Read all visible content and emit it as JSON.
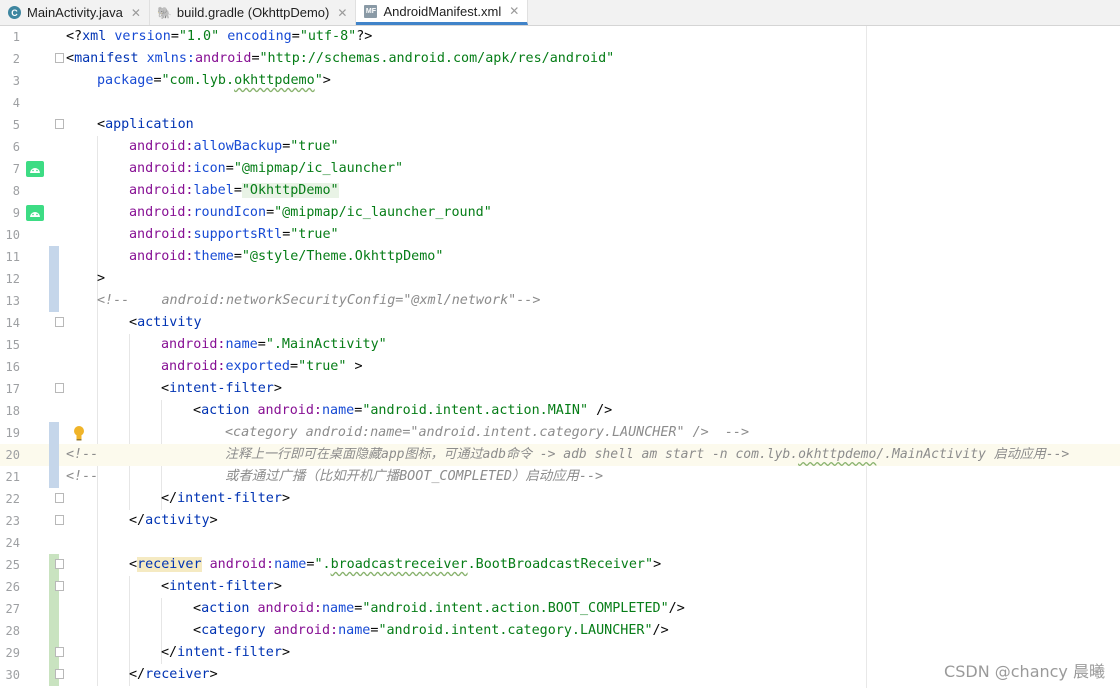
{
  "tabs": [
    {
      "label": "MainActivity.java",
      "icon": "class-icon",
      "active": false
    },
    {
      "label": "build.gradle (OkhttpDemo)",
      "icon": "gradle-elephant-icon",
      "active": false
    },
    {
      "label": "AndroidManifest.xml",
      "icon": "manifest-file-icon",
      "active": true
    }
  ],
  "line_numbers": [
    "1",
    "2",
    "3",
    "4",
    "5",
    "6",
    "7",
    "8",
    "9",
    "10",
    "11",
    "12",
    "13",
    "14",
    "15",
    "16",
    "17",
    "18",
    "19",
    "20",
    "21",
    "22",
    "23",
    "24",
    "25",
    "26",
    "27",
    "28",
    "29",
    "30"
  ],
  "code": {
    "l1": {
      "a": "<?",
      "b": "xml ",
      "c": "version",
      "d": "=",
      "e": "\"1.0\"",
      "f": " ",
      "g": "encoding",
      "h": "=",
      "i": "\"utf-8\"",
      "j": "?>"
    },
    "l2": {
      "a": "<",
      "b": "manifest ",
      "c": "xmlns:",
      "d": "android",
      "e": "=",
      "f": "\"http://schemas.android.com/apk/res/android\""
    },
    "l3": {
      "a": "package",
      "b": "=",
      "c": "\"com.lyb.",
      "d": "okhttpdemo",
      "e": "\"",
      "f": ">"
    },
    "l5": {
      "a": "<",
      "b": "application"
    },
    "l6": {
      "a": "android:",
      "b": "allowBackup",
      "c": "=",
      "d": "\"true\""
    },
    "l7": {
      "a": "android:",
      "b": "icon",
      "c": "=",
      "d": "\"@mipmap/ic_launcher\""
    },
    "l8": {
      "a": "android:",
      "b": "label",
      "c": "=",
      "d": "\"OkhttpDemo\""
    },
    "l9": {
      "a": "android:",
      "b": "roundIcon",
      "c": "=",
      "d": "\"@mipmap/ic_launcher_round\""
    },
    "l10": {
      "a": "android:",
      "b": "supportsRtl",
      "c": "=",
      "d": "\"true\""
    },
    "l11": {
      "a": "android:",
      "b": "theme",
      "c": "=",
      "d": "\"@style/Theme.OkhttpDemo\""
    },
    "l12": {
      "a": ">"
    },
    "l13": {
      "a": "<!--    android:networkSecurityConfig=\"@xml/network\"-->"
    },
    "l14": {
      "a": "<",
      "b": "activity"
    },
    "l15": {
      "a": "android:",
      "b": "name",
      "c": "=",
      "d": "\".MainActivity\""
    },
    "l16": {
      "a": "android:",
      "b": "exported",
      "c": "=",
      "d": "\"true\"",
      "e": " >"
    },
    "l17": {
      "a": "<",
      "b": "intent-filter",
      "c": ">"
    },
    "l18": {
      "a": "<",
      "b": "action ",
      "c": "android:",
      "d": "name",
      "e": "=",
      "f": "\"android.intent.action.MAIN\"",
      "g": " />"
    },
    "l19": {
      "a": "<!--",
      "b": "<category android:name=\"android.intent.category.LAUNCHER\" />  -->"
    },
    "l20": {
      "a": "<!--",
      "b": "注释上一行即可在桌面隐藏app图标，可通过adb命令 -> adb shell am start -n com.lyb.",
      "c": "okhttpdemo",
      "d": "/.MainActivity 启动应用-->"
    },
    "l21": {
      "a": "<!--",
      "b": "或者通过广播（比如开机广播BOOT_COMPLETED）启动应用-->"
    },
    "l22": {
      "a": "</",
      "b": "intent-filter",
      "c": ">"
    },
    "l23": {
      "a": "</",
      "b": "activity",
      "c": ">"
    },
    "l25": {
      "a": "<",
      "b": "receiver",
      "c": " ",
      "d": "android:",
      "e": "name",
      "f": "=",
      "g": "\".",
      "h": "broadcastreceiver",
      "i": ".BootBroadcastReceiver\"",
      "j": ">"
    },
    "l26": {
      "a": "<",
      "b": "intent-filter",
      "c": ">"
    },
    "l27": {
      "a": "<",
      "b": "action ",
      "c": "android:",
      "d": "name",
      "e": "=",
      "f": "\"android.intent.action.BOOT_COMPLETED\"",
      "g": "/>"
    },
    "l28": {
      "a": "<",
      "b": "category ",
      "c": "android:",
      "d": "name",
      "e": "=",
      "f": "\"android.intent.category.LAUNCHER\"",
      "g": "/>"
    },
    "l29": {
      "a": "</",
      "b": "intent-filter",
      "c": ">"
    },
    "l30": {
      "a": "</",
      "b": "receiver",
      "c": ">"
    }
  },
  "watermark": "CSDN @chancy 晨曦",
  "colors": {
    "tag": "#0033b3",
    "namespace": "#871094",
    "attribute": "#174ad4",
    "string": "#067d17",
    "comment": "#8c8c8c",
    "active_tab": "#4083c9",
    "android_green": "#3ddc84"
  }
}
